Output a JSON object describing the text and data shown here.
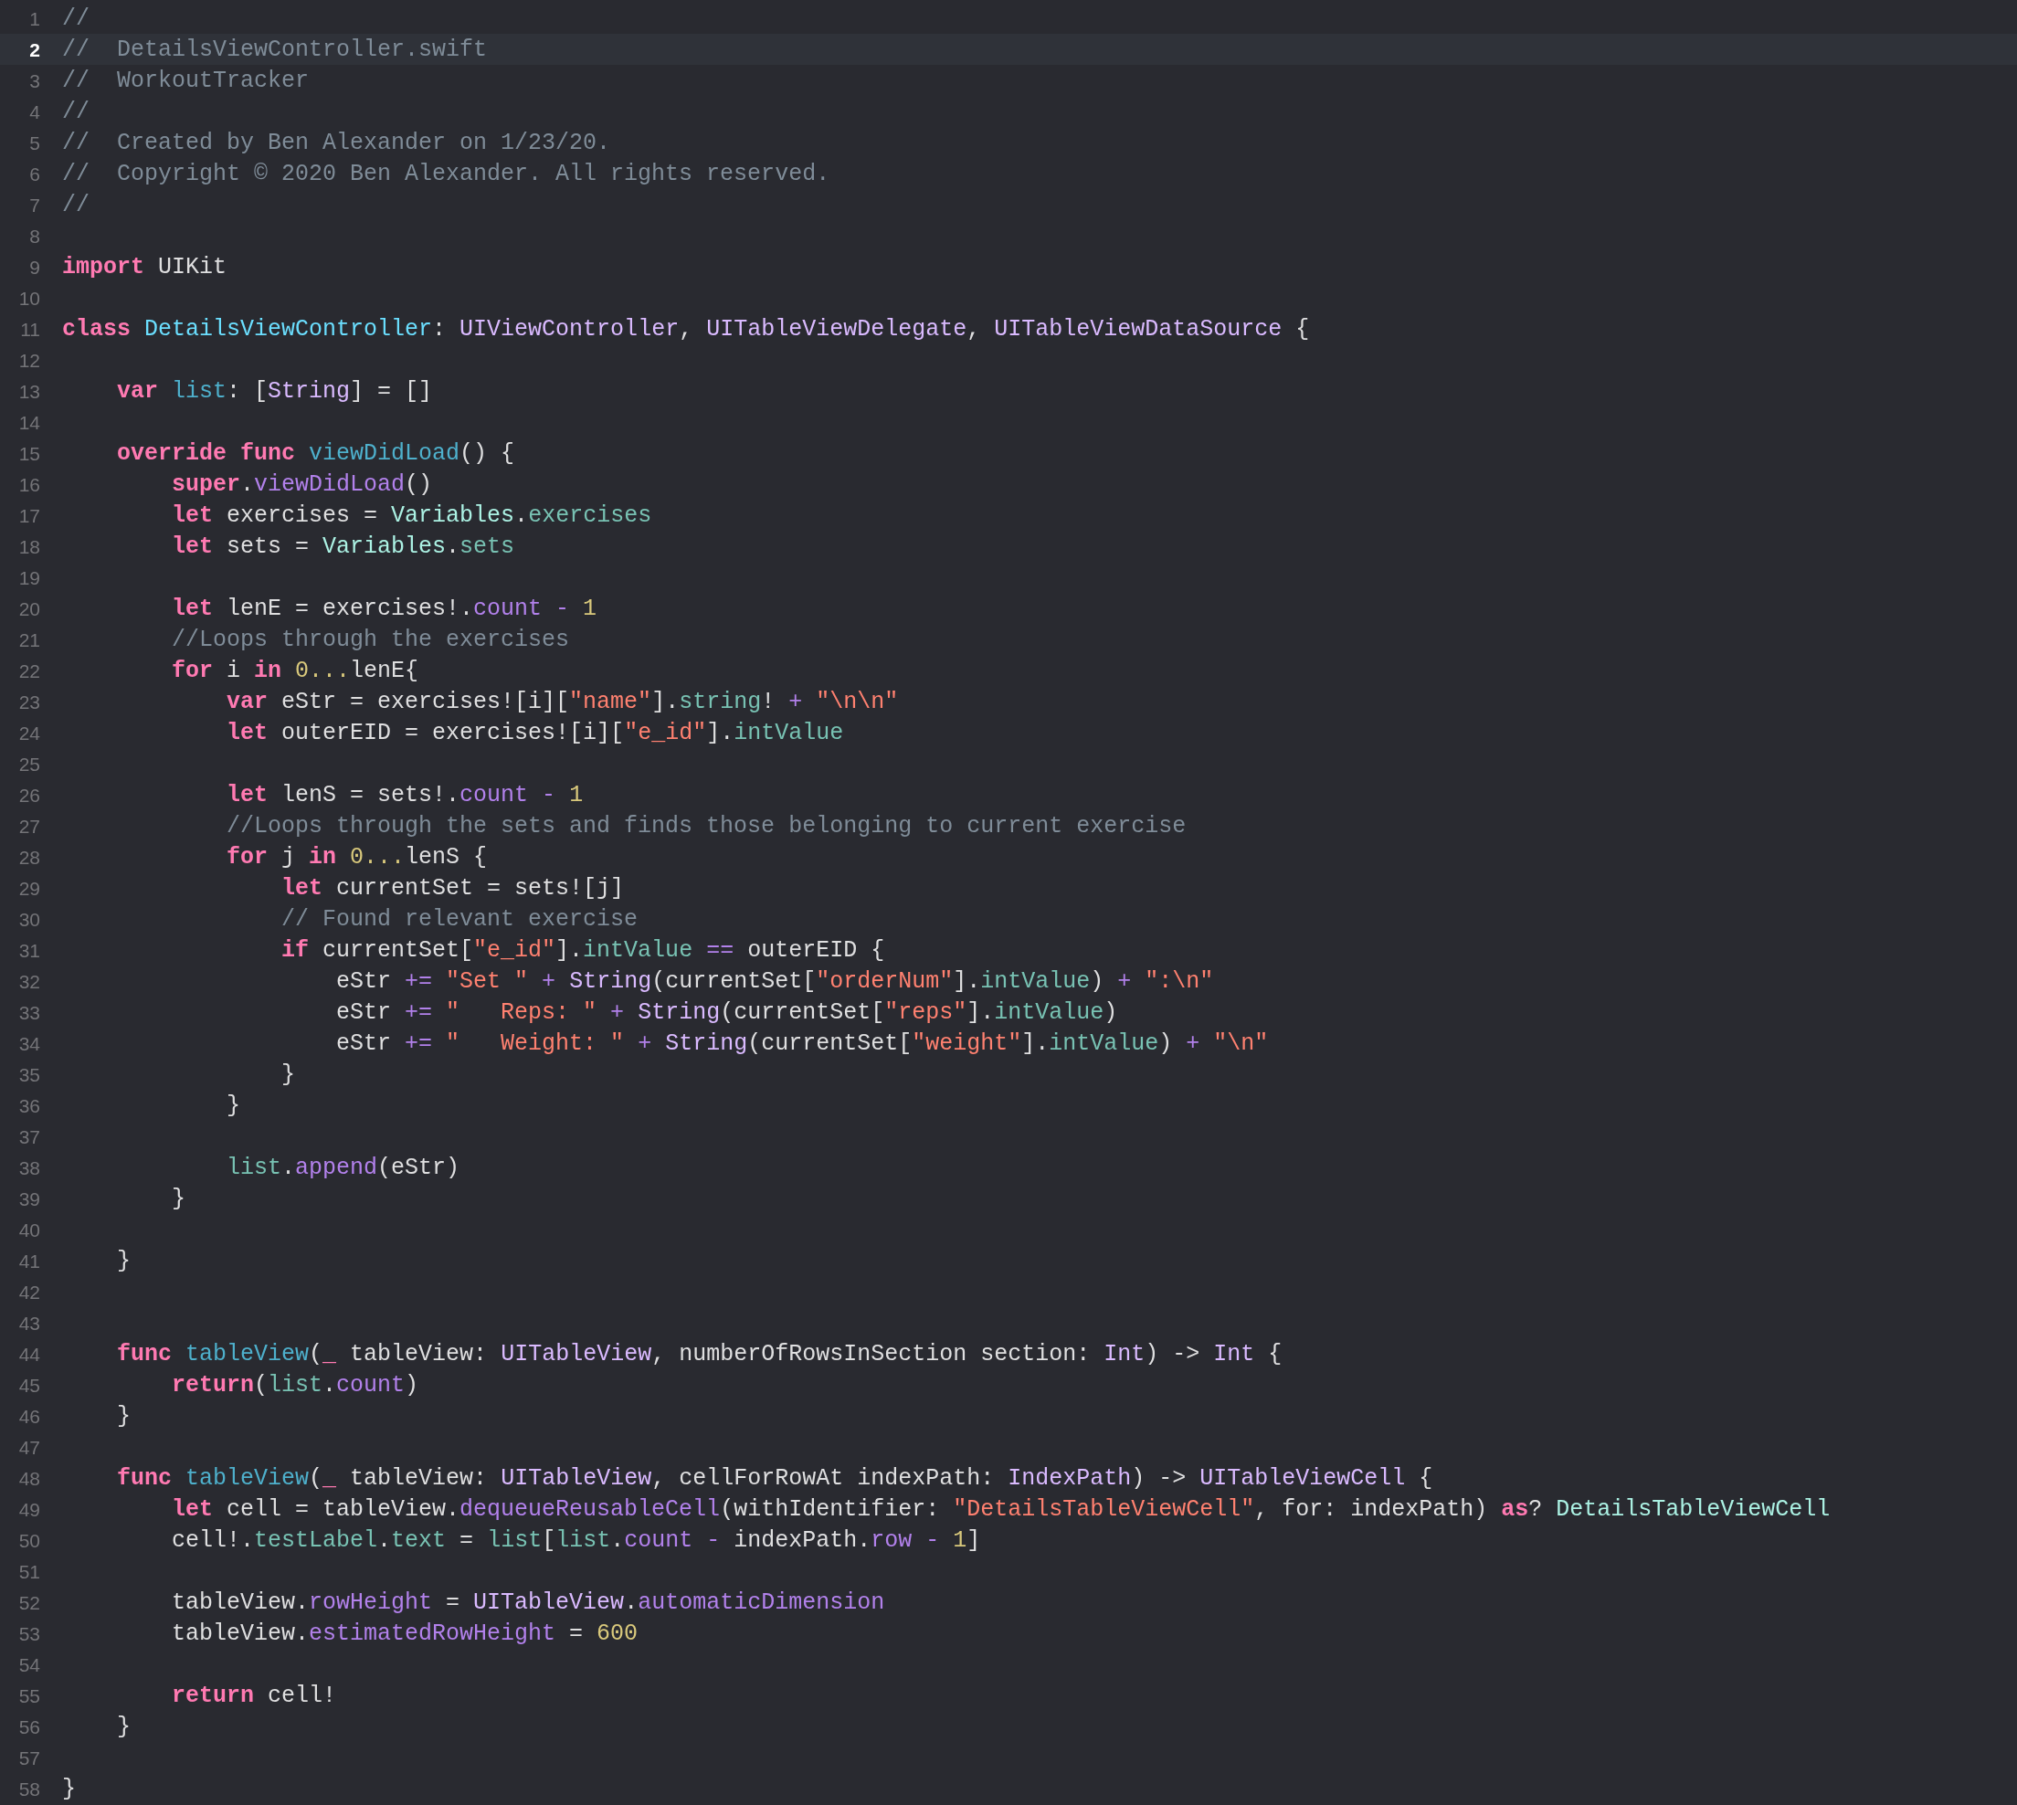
{
  "editor": {
    "lines": [
      {
        "number": "1",
        "current": false,
        "tokens": [
          {
            "kind": "comment",
            "text": "//"
          }
        ]
      },
      {
        "number": "2",
        "current": true,
        "tokens": [
          {
            "kind": "comment",
            "text": "//  DetailsViewController.swift"
          }
        ]
      },
      {
        "number": "3",
        "current": false,
        "tokens": [
          {
            "kind": "comment",
            "text": "//  WorkoutTracker"
          }
        ]
      },
      {
        "number": "4",
        "current": false,
        "tokens": [
          {
            "kind": "comment",
            "text": "//"
          }
        ]
      },
      {
        "number": "5",
        "current": false,
        "tokens": [
          {
            "kind": "comment",
            "text": "//  Created by Ben Alexander on 1/23/20."
          }
        ]
      },
      {
        "number": "6",
        "current": false,
        "tokens": [
          {
            "kind": "comment",
            "text": "//  Copyright © 2020 Ben Alexander. All rights reserved."
          }
        ]
      },
      {
        "number": "7",
        "current": false,
        "tokens": [
          {
            "kind": "comment",
            "text": "//"
          }
        ]
      },
      {
        "number": "8",
        "current": false
      },
      {
        "number": "9",
        "current": false,
        "tokens": [
          {
            "kind": "keyword",
            "text": "import"
          },
          {
            "kind": "plain",
            "text": " UIKit"
          }
        ]
      },
      {
        "number": "10",
        "current": false
      },
      {
        "number": "11",
        "current": false,
        "tokens": [
          {
            "kind": "keyword",
            "text": "class "
          },
          {
            "kind": "typedecl",
            "text": "DetailsViewController"
          },
          {
            "kind": "plain",
            "text": ": "
          },
          {
            "kind": "type",
            "text": "UIViewController"
          },
          {
            "kind": "plain",
            "text": ", "
          },
          {
            "kind": "type",
            "text": "UITableViewDelegate"
          },
          {
            "kind": "plain",
            "text": ", "
          },
          {
            "kind": "type",
            "text": "UITableViewDataSource"
          },
          {
            "kind": "plain",
            "text": " {"
          }
        ]
      },
      {
        "number": "12",
        "current": false
      },
      {
        "number": "13",
        "current": false,
        "tokens": [
          {
            "kind": "keyword",
            "text": "    var "
          },
          {
            "kind": "decl",
            "text": "list"
          },
          {
            "kind": "plain",
            "text": ": ["
          },
          {
            "kind": "type",
            "text": "String"
          },
          {
            "kind": "plain",
            "text": "] = []"
          }
        ]
      },
      {
        "number": "14",
        "current": false
      },
      {
        "number": "15",
        "current": false,
        "tokens": [
          {
            "kind": "keyword",
            "text": "    override func "
          },
          {
            "kind": "decl",
            "text": "viewDidLoad"
          },
          {
            "kind": "plain",
            "text": "() {"
          }
        ]
      },
      {
        "number": "16",
        "current": false,
        "tokens": [
          {
            "kind": "keyword",
            "text": "        super"
          },
          {
            "kind": "plain",
            "text": "."
          },
          {
            "kind": "member",
            "text": "viewDidLoad"
          },
          {
            "kind": "plain",
            "text": "()"
          }
        ]
      },
      {
        "number": "17",
        "current": false,
        "tokens": [
          {
            "kind": "keyword",
            "text": "        let"
          },
          {
            "kind": "plain",
            "text": " exercises = "
          },
          {
            "kind": "projtype",
            "text": "Variables"
          },
          {
            "kind": "plain",
            "text": "."
          },
          {
            "kind": "projmember",
            "text": "exercises"
          }
        ]
      },
      {
        "number": "18",
        "current": false,
        "tokens": [
          {
            "kind": "keyword",
            "text": "        let"
          },
          {
            "kind": "plain",
            "text": " sets = "
          },
          {
            "kind": "projtype",
            "text": "Variables"
          },
          {
            "kind": "plain",
            "text": "."
          },
          {
            "kind": "projmember",
            "text": "sets"
          }
        ]
      },
      {
        "number": "19",
        "current": false
      },
      {
        "number": "20",
        "current": false,
        "tokens": [
          {
            "kind": "keyword",
            "text": "        let"
          },
          {
            "kind": "plain",
            "text": " lenE = exercises!."
          },
          {
            "kind": "member",
            "text": "count "
          },
          {
            "kind": "member",
            "text": "- "
          },
          {
            "kind": "number",
            "text": "1"
          }
        ]
      },
      {
        "number": "21",
        "current": false,
        "tokens": [
          {
            "kind": "comment",
            "text": "        //Loops through the exercises"
          }
        ]
      },
      {
        "number": "22",
        "current": false,
        "tokens": [
          {
            "kind": "keyword",
            "text": "        for"
          },
          {
            "kind": "plain",
            "text": " i "
          },
          {
            "kind": "keyword",
            "text": "in "
          },
          {
            "kind": "number",
            "text": "0..."
          },
          {
            "kind": "plain",
            "text": "lenE{"
          }
        ]
      },
      {
        "number": "23",
        "current": false,
        "tokens": [
          {
            "kind": "keyword",
            "text": "            var"
          },
          {
            "kind": "plain",
            "text": " eStr = exercises![i]["
          },
          {
            "kind": "string",
            "text": "\"name\""
          },
          {
            "kind": "plain",
            "text": "]."
          },
          {
            "kind": "projmember",
            "text": "string"
          },
          {
            "kind": "plain",
            "text": "! "
          },
          {
            "kind": "member",
            "text": "+ "
          },
          {
            "kind": "string",
            "text": "\"\\n\\n\""
          }
        ]
      },
      {
        "number": "24",
        "current": false,
        "tokens": [
          {
            "kind": "keyword",
            "text": "            let"
          },
          {
            "kind": "plain",
            "text": " outerEID = exercises![i]["
          },
          {
            "kind": "string",
            "text": "\"e_id\""
          },
          {
            "kind": "plain",
            "text": "]."
          },
          {
            "kind": "projmember",
            "text": "intValue"
          }
        ]
      },
      {
        "number": "25",
        "current": false
      },
      {
        "number": "26",
        "current": false,
        "tokens": [
          {
            "kind": "keyword",
            "text": "            let"
          },
          {
            "kind": "plain",
            "text": " lenS = sets!."
          },
          {
            "kind": "member",
            "text": "count "
          },
          {
            "kind": "member",
            "text": "- "
          },
          {
            "kind": "number",
            "text": "1"
          }
        ]
      },
      {
        "number": "27",
        "current": false,
        "tokens": [
          {
            "kind": "comment",
            "text": "            //Loops through the sets and finds those belonging to current exercise"
          }
        ]
      },
      {
        "number": "28",
        "current": false,
        "tokens": [
          {
            "kind": "keyword",
            "text": "            for"
          },
          {
            "kind": "plain",
            "text": " j "
          },
          {
            "kind": "keyword",
            "text": "in "
          },
          {
            "kind": "number",
            "text": "0..."
          },
          {
            "kind": "plain",
            "text": "lenS {"
          }
        ]
      },
      {
        "number": "29",
        "current": false,
        "tokens": [
          {
            "kind": "keyword",
            "text": "                let"
          },
          {
            "kind": "plain",
            "text": " currentSet = sets![j]"
          }
        ]
      },
      {
        "number": "30",
        "current": false,
        "tokens": [
          {
            "kind": "comment",
            "text": "                // Found relevant exercise"
          }
        ]
      },
      {
        "number": "31",
        "current": false,
        "tokens": [
          {
            "kind": "keyword",
            "text": "                if"
          },
          {
            "kind": "plain",
            "text": " currentSet["
          },
          {
            "kind": "string",
            "text": "\"e_id\""
          },
          {
            "kind": "plain",
            "text": "]."
          },
          {
            "kind": "projmember",
            "text": "intValue "
          },
          {
            "kind": "member",
            "text": "=="
          },
          {
            "kind": "plain",
            "text": " outerEID {"
          }
        ]
      },
      {
        "number": "32",
        "current": false,
        "tokens": [
          {
            "kind": "plain",
            "text": "                    eStr "
          },
          {
            "kind": "member",
            "text": "+= "
          },
          {
            "kind": "string",
            "text": "\"Set \" "
          },
          {
            "kind": "member",
            "text": "+ "
          },
          {
            "kind": "type",
            "text": "String"
          },
          {
            "kind": "plain",
            "text": "(currentSet["
          },
          {
            "kind": "string",
            "text": "\"orderNum\""
          },
          {
            "kind": "plain",
            "text": "]."
          },
          {
            "kind": "projmember",
            "text": "intValue"
          },
          {
            "kind": "plain",
            "text": ") "
          },
          {
            "kind": "member",
            "text": "+ "
          },
          {
            "kind": "string",
            "text": "\":\\n\""
          }
        ]
      },
      {
        "number": "33",
        "current": false,
        "tokens": [
          {
            "kind": "plain",
            "text": "                    eStr "
          },
          {
            "kind": "member",
            "text": "+= "
          },
          {
            "kind": "string",
            "text": "\"   Reps: \" "
          },
          {
            "kind": "member",
            "text": "+ "
          },
          {
            "kind": "type",
            "text": "String"
          },
          {
            "kind": "plain",
            "text": "(currentSet["
          },
          {
            "kind": "string",
            "text": "\"reps\""
          },
          {
            "kind": "plain",
            "text": "]."
          },
          {
            "kind": "projmember",
            "text": "intValue"
          },
          {
            "kind": "plain",
            "text": ")"
          }
        ]
      },
      {
        "number": "34",
        "current": false,
        "tokens": [
          {
            "kind": "plain",
            "text": "                    eStr "
          },
          {
            "kind": "member",
            "text": "+= "
          },
          {
            "kind": "string",
            "text": "\"   Weight: \" "
          },
          {
            "kind": "member",
            "text": "+ "
          },
          {
            "kind": "type",
            "text": "String"
          },
          {
            "kind": "plain",
            "text": "(currentSet["
          },
          {
            "kind": "string",
            "text": "\"weight\""
          },
          {
            "kind": "plain",
            "text": "]."
          },
          {
            "kind": "projmember",
            "text": "intValue"
          },
          {
            "kind": "plain",
            "text": ") "
          },
          {
            "kind": "member",
            "text": "+ "
          },
          {
            "kind": "string",
            "text": "\"\\n\""
          }
        ]
      },
      {
        "number": "35",
        "current": false,
        "tokens": [
          {
            "kind": "plain",
            "text": "                }"
          }
        ]
      },
      {
        "number": "36",
        "current": false,
        "tokens": [
          {
            "kind": "plain",
            "text": "            }"
          }
        ]
      },
      {
        "number": "37",
        "current": false
      },
      {
        "number": "38",
        "current": false,
        "tokens": [
          {
            "kind": "projmember",
            "text": "            list"
          },
          {
            "kind": "plain",
            "text": "."
          },
          {
            "kind": "member",
            "text": "append"
          },
          {
            "kind": "plain",
            "text": "(eStr)"
          }
        ]
      },
      {
        "number": "39",
        "current": false,
        "tokens": [
          {
            "kind": "plain",
            "text": "        }"
          }
        ]
      },
      {
        "number": "40",
        "current": false
      },
      {
        "number": "41",
        "current": false,
        "tokens": [
          {
            "kind": "plain",
            "text": "    }"
          }
        ]
      },
      {
        "number": "42",
        "current": false
      },
      {
        "number": "43",
        "current": false
      },
      {
        "number": "44",
        "current": false,
        "tokens": [
          {
            "kind": "keyword",
            "text": "    func "
          },
          {
            "kind": "decl",
            "text": "tableView"
          },
          {
            "kind": "plain",
            "text": "("
          },
          {
            "kind": "keyword",
            "text": "_"
          },
          {
            "kind": "plain",
            "text": " tableView: "
          },
          {
            "kind": "type",
            "text": "UITableView"
          },
          {
            "kind": "plain",
            "text": ", numberOfRowsInSection section: "
          },
          {
            "kind": "type",
            "text": "Int"
          },
          {
            "kind": "plain",
            "text": ") -> "
          },
          {
            "kind": "type",
            "text": "Int"
          },
          {
            "kind": "plain",
            "text": " {"
          }
        ]
      },
      {
        "number": "45",
        "current": false,
        "tokens": [
          {
            "kind": "keyword",
            "text": "        return"
          },
          {
            "kind": "plain",
            "text": "("
          },
          {
            "kind": "projmember",
            "text": "list"
          },
          {
            "kind": "plain",
            "text": "."
          },
          {
            "kind": "member",
            "text": "count"
          },
          {
            "kind": "plain",
            "text": ")"
          }
        ]
      },
      {
        "number": "46",
        "current": false,
        "tokens": [
          {
            "kind": "plain",
            "text": "    }"
          }
        ]
      },
      {
        "number": "47",
        "current": false
      },
      {
        "number": "48",
        "current": false,
        "tokens": [
          {
            "kind": "keyword",
            "text": "    func "
          },
          {
            "kind": "decl",
            "text": "tableView"
          },
          {
            "kind": "plain",
            "text": "("
          },
          {
            "kind": "keyword",
            "text": "_"
          },
          {
            "kind": "plain",
            "text": " tableView: "
          },
          {
            "kind": "type",
            "text": "UITableView"
          },
          {
            "kind": "plain",
            "text": ", cellForRowAt indexPath: "
          },
          {
            "kind": "type",
            "text": "IndexPath"
          },
          {
            "kind": "plain",
            "text": ") -> "
          },
          {
            "kind": "type",
            "text": "UITableViewCell"
          },
          {
            "kind": "plain",
            "text": " {"
          }
        ]
      },
      {
        "number": "49",
        "current": false,
        "tokens": [
          {
            "kind": "keyword",
            "text": "        let"
          },
          {
            "kind": "plain",
            "text": " cell = tableView."
          },
          {
            "kind": "member",
            "text": "dequeueReusableCell"
          },
          {
            "kind": "plain",
            "text": "(withIdentifier: "
          },
          {
            "kind": "string",
            "text": "\"DetailsTableViewCell\""
          },
          {
            "kind": "plain",
            "text": ", for: indexPath) "
          },
          {
            "kind": "keyword",
            "text": "as"
          },
          {
            "kind": "plain",
            "text": "? "
          },
          {
            "kind": "projtype",
            "text": "DetailsTableViewCell"
          }
        ]
      },
      {
        "number": "50",
        "current": false,
        "tokens": [
          {
            "kind": "plain",
            "text": "        cell!."
          },
          {
            "kind": "projmember",
            "text": "testLabel"
          },
          {
            "kind": "plain",
            "text": "."
          },
          {
            "kind": "projmember",
            "text": "text"
          },
          {
            "kind": "plain",
            "text": " = "
          },
          {
            "kind": "projmember",
            "text": "list"
          },
          {
            "kind": "plain",
            "text": "["
          },
          {
            "kind": "projmember",
            "text": "list"
          },
          {
            "kind": "plain",
            "text": "."
          },
          {
            "kind": "member",
            "text": "count "
          },
          {
            "kind": "member",
            "text": "-"
          },
          {
            "kind": "plain",
            "text": " indexPath."
          },
          {
            "kind": "member",
            "text": "row "
          },
          {
            "kind": "member",
            "text": "- "
          },
          {
            "kind": "number",
            "text": "1"
          },
          {
            "kind": "plain",
            "text": "]"
          }
        ]
      },
      {
        "number": "51",
        "current": false
      },
      {
        "number": "52",
        "current": false,
        "tokens": [
          {
            "kind": "plain",
            "text": "        tableView."
          },
          {
            "kind": "member",
            "text": "rowHeight"
          },
          {
            "kind": "plain",
            "text": " = "
          },
          {
            "kind": "type",
            "text": "UITableView"
          },
          {
            "kind": "plain",
            "text": "."
          },
          {
            "kind": "member",
            "text": "automaticDimension"
          }
        ]
      },
      {
        "number": "53",
        "current": false,
        "tokens": [
          {
            "kind": "plain",
            "text": "        tableView."
          },
          {
            "kind": "member",
            "text": "estimatedRowHeight"
          },
          {
            "kind": "plain",
            "text": " = "
          },
          {
            "kind": "number",
            "text": "600"
          }
        ]
      },
      {
        "number": "54",
        "current": false
      },
      {
        "number": "55",
        "current": false,
        "tokens": [
          {
            "kind": "keyword",
            "text": "        return"
          },
          {
            "kind": "plain",
            "text": " cell!"
          }
        ]
      },
      {
        "number": "56",
        "current": false,
        "tokens": [
          {
            "kind": "plain",
            "text": "    }"
          }
        ]
      },
      {
        "number": "57",
        "current": false
      },
      {
        "number": "58",
        "current": false,
        "tokens": [
          {
            "kind": "plain",
            "text": "}"
          }
        ]
      }
    ]
  }
}
